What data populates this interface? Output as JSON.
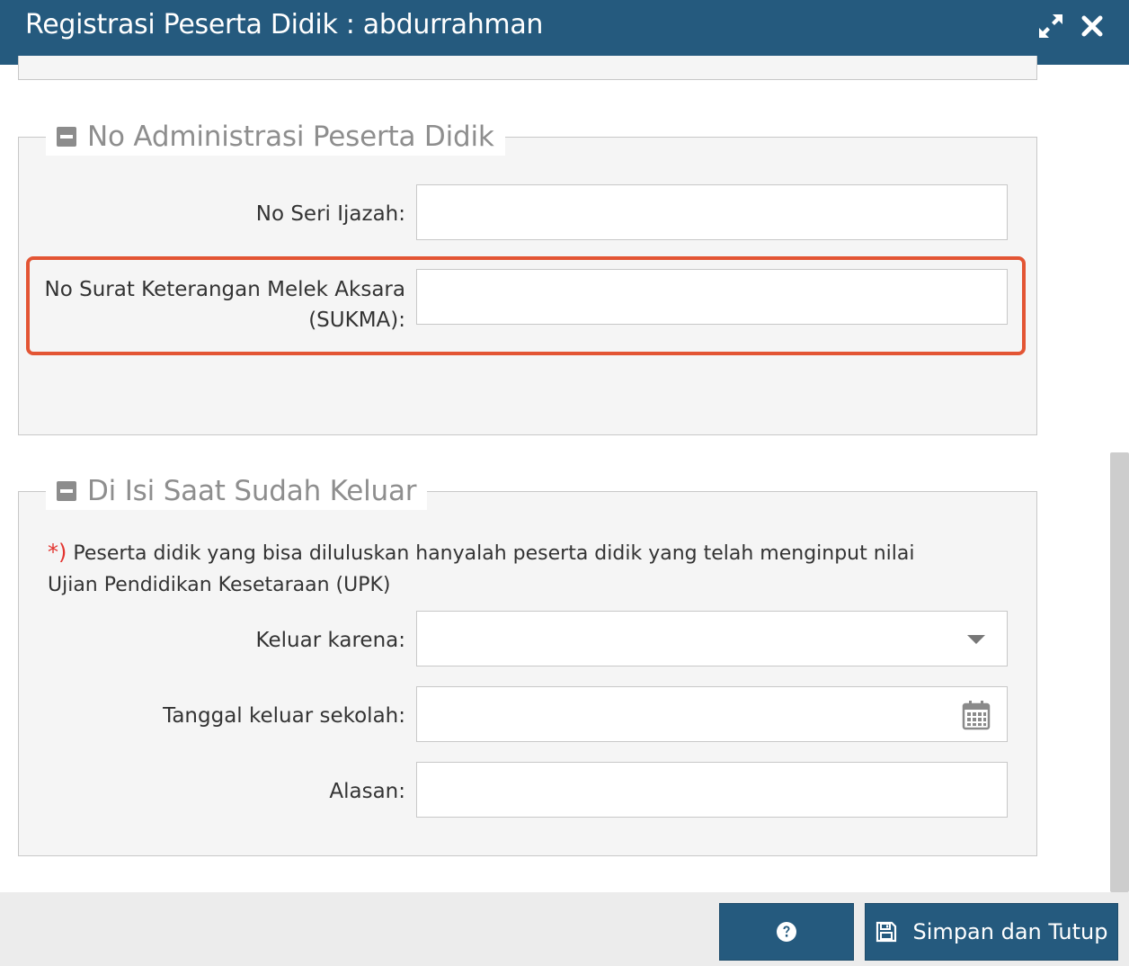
{
  "window": {
    "title": "Registrasi Peserta Didik : abdurrahman",
    "expand_icon": "expand-icon",
    "close_icon": "close-icon"
  },
  "section_admin": {
    "legend": "No Administrasi Peserta Didik",
    "toggle_icon": "minus-square-icon",
    "fields": {
      "no_seri_ijazah": {
        "label": "No Seri Ijazah:",
        "value": ""
      },
      "no_sukma": {
        "label_line1": "No Surat Keterangan Melek Aksara",
        "label_line2": "(SUKMA):",
        "value": ""
      }
    },
    "highlight_color": "#e35534"
  },
  "section_keluar": {
    "legend": "Di Isi Saat Sudah Keluar",
    "toggle_icon": "minus-square-icon",
    "note_marker": "*)",
    "note_text": "Peserta didik yang bisa diluluskan hanyalah peserta didik yang telah menginput nilai Ujian Pendidikan Kesetaraan (UPK)",
    "fields": {
      "keluar_karena": {
        "label": "Keluar karena:",
        "value": "",
        "icon": "chevron-down-icon"
      },
      "tanggal_keluar": {
        "label": "Tanggal keluar sekolah:",
        "value": "",
        "icon": "calendar-icon"
      },
      "alasan": {
        "label": "Alasan:",
        "value": ""
      }
    }
  },
  "footer": {
    "help_icon": "question-circle-icon",
    "save_icon": "floppy-disk-icon",
    "save_label": "Simpan dan Tutup"
  },
  "colors": {
    "header": "#255a7e",
    "button": "#255a7e",
    "panel": "#f5f5f5",
    "required_marker": "#e3342f"
  }
}
